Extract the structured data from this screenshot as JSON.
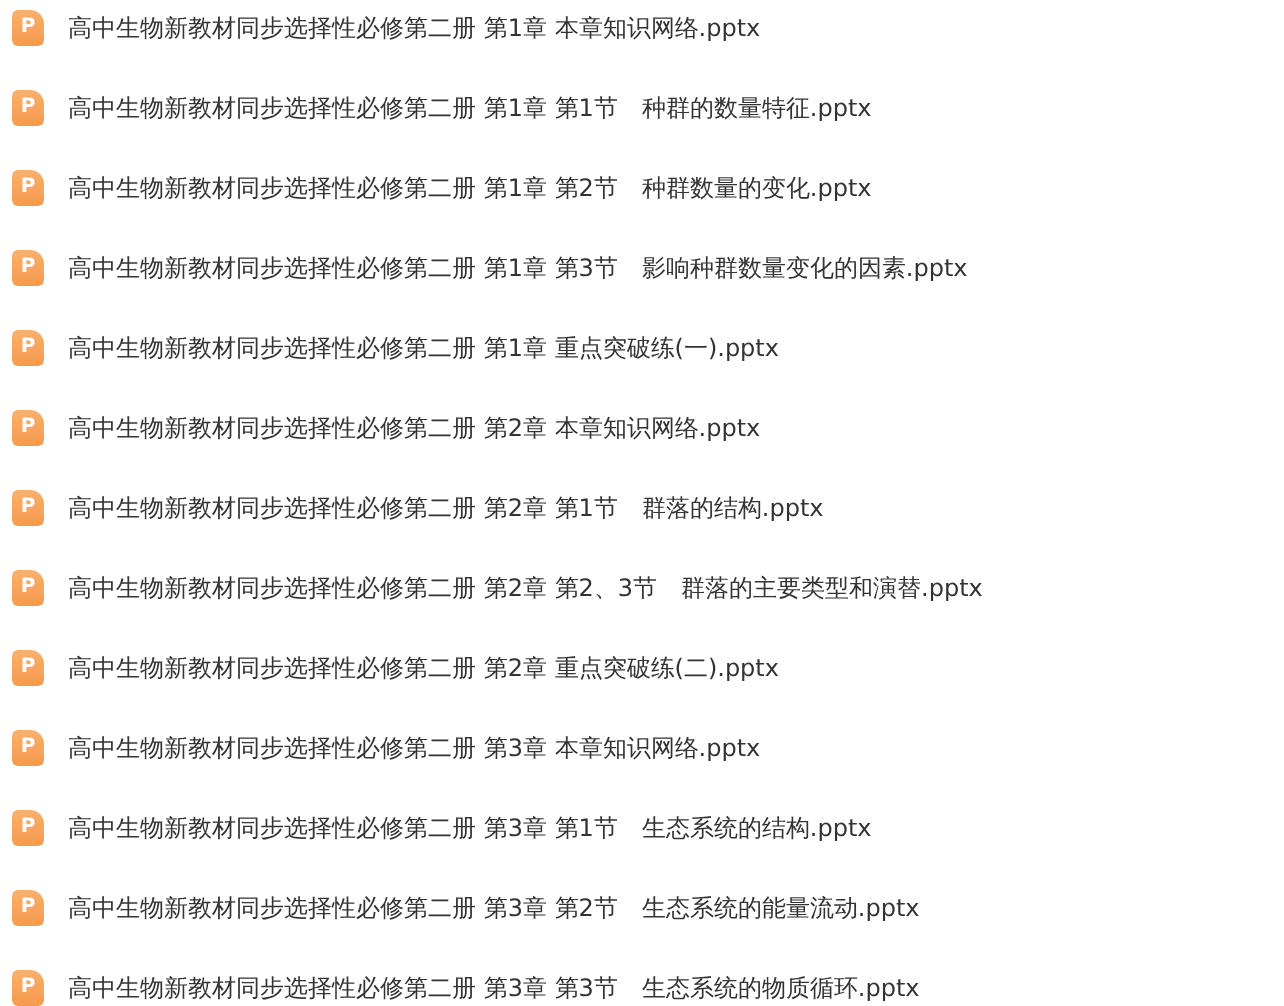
{
  "files": [
    {
      "icon_text": "P",
      "name": "高中生物新教材同步选择性必修第二册 第1章 本章知识网络.pptx"
    },
    {
      "icon_text": "P",
      "name": "高中生物新教材同步选择性必修第二册 第1章 第1节　种群的数量特征.pptx"
    },
    {
      "icon_text": "P",
      "name": "高中生物新教材同步选择性必修第二册 第1章 第2节　种群数量的变化.pptx"
    },
    {
      "icon_text": "P",
      "name": "高中生物新教材同步选择性必修第二册 第1章 第3节　影响种群数量变化的因素.pptx"
    },
    {
      "icon_text": "P",
      "name": "高中生物新教材同步选择性必修第二册 第1章 重点突破练(一).pptx"
    },
    {
      "icon_text": "P",
      "name": "高中生物新教材同步选择性必修第二册 第2章 本章知识网络.pptx"
    },
    {
      "icon_text": "P",
      "name": "高中生物新教材同步选择性必修第二册 第2章 第1节　群落的结构.pptx"
    },
    {
      "icon_text": "P",
      "name": "高中生物新教材同步选择性必修第二册 第2章 第2、3节　群落的主要类型和演替.pptx"
    },
    {
      "icon_text": "P",
      "name": "高中生物新教材同步选择性必修第二册 第2章 重点突破练(二).pptx"
    },
    {
      "icon_text": "P",
      "name": "高中生物新教材同步选择性必修第二册 第3章 本章知识网络.pptx"
    },
    {
      "icon_text": "P",
      "name": "高中生物新教材同步选择性必修第二册 第3章 第1节　生态系统的结构.pptx"
    },
    {
      "icon_text": "P",
      "name": "高中生物新教材同步选择性必修第二册 第3章 第2节　生态系统的能量流动.pptx"
    },
    {
      "icon_text": "P",
      "name": "高中生物新教材同步选择性必修第二册 第3章 第3节　生态系统的物质循环.pptx"
    }
  ]
}
